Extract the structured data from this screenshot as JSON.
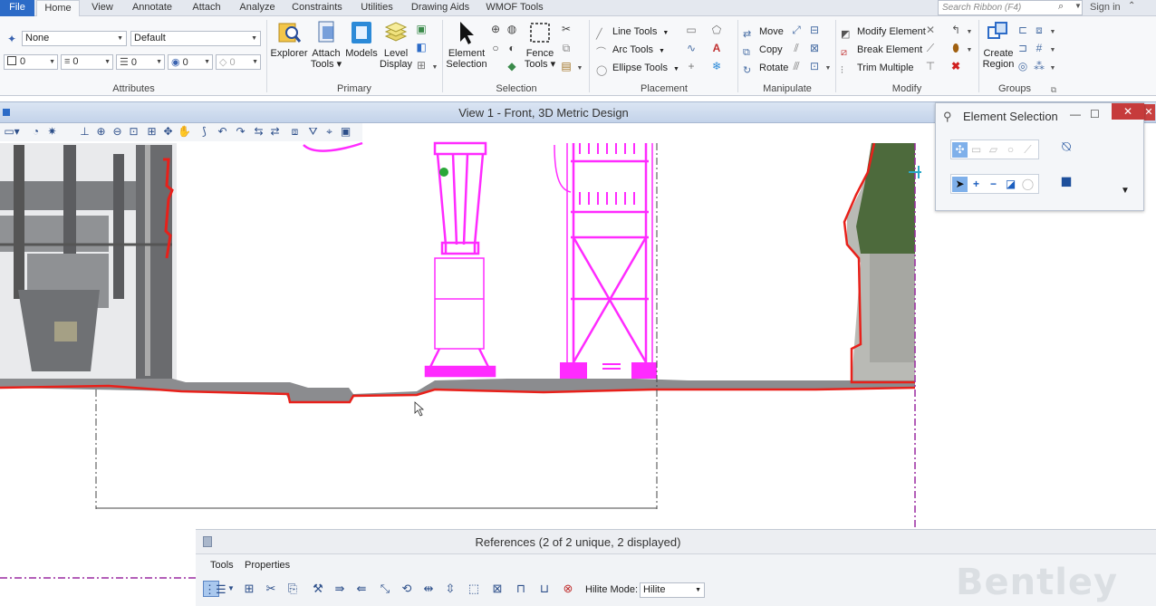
{
  "tabs": [
    {
      "label": "File"
    },
    {
      "label": "Home"
    },
    {
      "label": "View"
    },
    {
      "label": "Annotate"
    },
    {
      "label": "Attach"
    },
    {
      "label": "Analyze"
    },
    {
      "label": "Constraints"
    },
    {
      "label": "Utilities"
    },
    {
      "label": "Drawing Aids"
    },
    {
      "label": "WMOF Tools"
    }
  ],
  "search": {
    "placeholder": "Search Ribbon (F4)"
  },
  "signin": "Sign in",
  "attributes": {
    "group_label": "Attributes",
    "level": "None",
    "style": "Default",
    "color": "0",
    "linestyle": "0",
    "weight": "0",
    "transparency": "0",
    "priority": "0"
  },
  "primary": {
    "group_label": "Primary",
    "explorer": "Explorer",
    "attach_tools": [
      "Attach",
      "Tools ▾"
    ],
    "models": "Models",
    "level_display": [
      "Level",
      "Display"
    ]
  },
  "selection": {
    "group_label": "Selection",
    "element_selection": [
      "Element",
      "Selection"
    ],
    "fence_tools": [
      "Fence",
      "Tools ▾"
    ]
  },
  "placement": {
    "group_label": "Placement",
    "line_tools": "Line Tools",
    "arc_tools": "Arc Tools",
    "ellipse_tools": "Ellipse Tools"
  },
  "manipulate": {
    "group_label": "Manipulate",
    "move": "Move",
    "copy": "Copy",
    "rotate": "Rotate"
  },
  "modify": {
    "group_label": "Modify",
    "modify_element": "Modify Element",
    "break_element": "Break Element",
    "trim_multiple": "Trim Multiple"
  },
  "groups": {
    "group_label": "Groups",
    "create_region": [
      "Create",
      "Region"
    ]
  },
  "view": {
    "title": "View 1 - Front, 3D Metric Design"
  },
  "element_selection_dialog": {
    "title": "Element Selection"
  },
  "references": {
    "title": "References (2 of 2 unique, 2 displayed)",
    "menu": [
      "Tools",
      "Properties"
    ],
    "hilite_label": "Hilite Mode:",
    "hilite_value": "Hilite"
  },
  "watermark": "Bentley",
  "colors": {
    "accent": "#2c6bc7",
    "magenta": "#ff2bff",
    "boundary": "#e8201a"
  }
}
